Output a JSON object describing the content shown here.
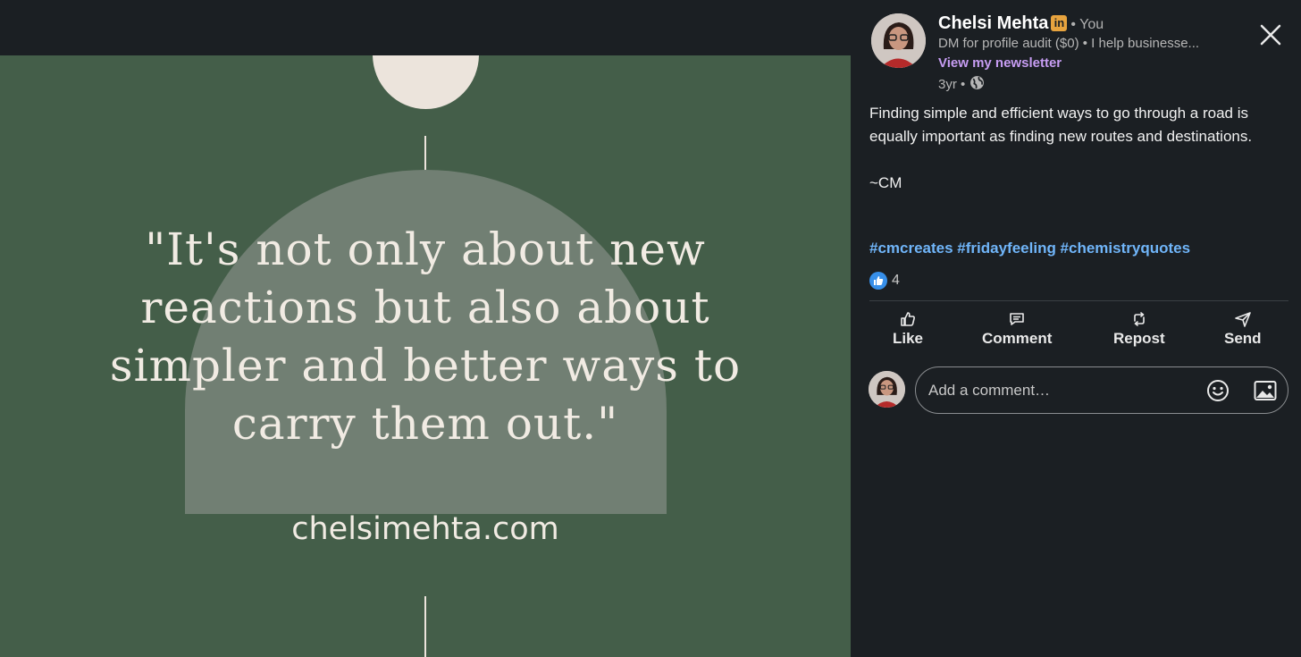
{
  "image_card": {
    "quote": "\"It's not only about new reactions but also about simpler and better ways to carry them out.\"",
    "website": "chelsimehta.com"
  },
  "author": {
    "name": "Chelsi Mehta",
    "badge_text": "in",
    "relationship": "• You",
    "headline": "DM for profile audit ($0) • I help businesse...",
    "newsletter_link": "View my newsletter",
    "timestamp": "3yr •"
  },
  "post": {
    "text_line1": "Finding simple and efficient ways to go through a road is equally important as finding new routes and destinations.",
    "signature": "~CM",
    "hashtags": "#cmcreates #fridayfeeling #chemistryquotes"
  },
  "reactions": {
    "count": "4"
  },
  "actions": {
    "like": "Like",
    "comment": "Comment",
    "repost": "Repost",
    "send": "Send"
  },
  "comment_input": {
    "placeholder": "Add a comment…"
  },
  "colors": {
    "image_bg": "#445e49",
    "arch": "#717f73",
    "accent_link": "#70b5f9",
    "newsletter": "#c79df3",
    "badge": "#e7a33e"
  }
}
